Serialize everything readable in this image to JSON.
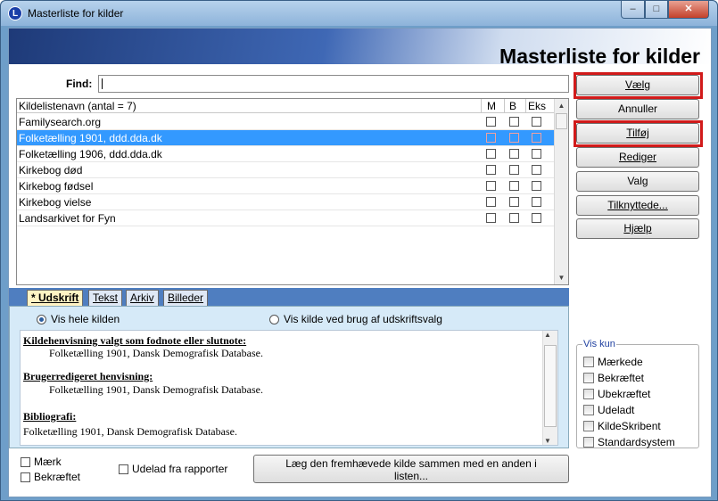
{
  "window": {
    "title": "Masterliste for kilder",
    "app_icon": "L",
    "controls": {
      "minimize": "–",
      "maximize": "□",
      "close": "✕"
    }
  },
  "header": {
    "title": "Masterliste for kilder"
  },
  "find": {
    "label": "Find:",
    "value": ""
  },
  "list": {
    "headers": {
      "name": "Kildelistenavn (antal = 7)",
      "m": "M",
      "b": "B",
      "eks": "Eks"
    },
    "rows": [
      {
        "name": "Familysearch.org",
        "selected": false
      },
      {
        "name": "Folketælling 1901, ddd.dda.dk",
        "selected": true
      },
      {
        "name": "Folketælling 1906, ddd.dda.dk",
        "selected": false
      },
      {
        "name": "Kirkebog død",
        "selected": false
      },
      {
        "name": "Kirkebog fødsel",
        "selected": false
      },
      {
        "name": "Kirkebog vielse",
        "selected": false
      },
      {
        "name": "Landsarkivet for Fyn",
        "selected": false
      }
    ]
  },
  "buttons": {
    "vaelg": "Vælg",
    "annuller": "Annuller",
    "tilfoj": "Tilføj",
    "rediger": "Rediger",
    "valg": "Valg",
    "tilknyttede": "Tilknyttede...",
    "hjaelp": "Hjælp"
  },
  "tabs": [
    "* Udskrift",
    "Tekst",
    "Arkiv",
    "Billeder"
  ],
  "udskrift": {
    "radio_all": "Vis hele kilden",
    "radio_print": "Vis kilde ved brug af udskriftsvalg",
    "sections": [
      {
        "heading": "Kildehenvisning valgt som fodnote eller slutnote:",
        "text": "Folketælling 1901, Dansk Demografisk Database."
      },
      {
        "heading": "Brugerredigeret henvisning:",
        "text": "Folketælling 1901, Dansk Demografisk Database."
      },
      {
        "heading": "Bibliografi:",
        "text": "Folketælling 1901, Dansk Demografisk Database."
      }
    ]
  },
  "bottom": {
    "maerk": "Mærk",
    "bekraeftet": "Bekræftet",
    "udelad": "Udelad fra rapporter",
    "merge_line1": "Læg den fremhævede kilde sammen med en anden i",
    "merge_line2": "listen..."
  },
  "vis_kun": {
    "title": "Vis kun",
    "options": [
      "Mærkede",
      "Bekræftet",
      "Ubekræftet",
      "Udeladt",
      "KildeSkribent",
      "Standardsystem"
    ]
  }
}
